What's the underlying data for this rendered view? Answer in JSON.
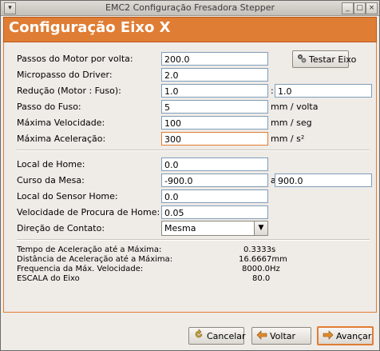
{
  "window": {
    "title": "EMC2 Configuração Fresadora Stepper",
    "menu_icon": "window-menu-icon",
    "min_icon": "minimize-icon",
    "max_icon": "maximize-icon",
    "close_icon": "close-icon"
  },
  "header": {
    "title": "Configuração Eixo X",
    "accent": "#e07d34"
  },
  "motor": {
    "steps_label": "Passos do Motor por volta:",
    "steps_value": "200.0",
    "microstep_label": "Micropasso do Driver:",
    "microstep_value": "2.0",
    "reduction_label": "Redução (Motor : Fuso):",
    "reduction_motor": "1.0",
    "reduction_sep": ":",
    "reduction_screw": "1.0",
    "pitch_label": "Passo do Fuso:",
    "pitch_value": "5",
    "pitch_unit": "mm / volta",
    "maxvel_label": "Máxima Velocidade:",
    "maxvel_value": "100",
    "maxvel_unit": "mm / seg",
    "maxacc_label": "Máxima Aceleração:",
    "maxacc_value": "300",
    "maxacc_unit": "mm / s²"
  },
  "test_button": {
    "label": "Testar Eixo",
    "icon": "gears-icon"
  },
  "home": {
    "home_label": "Local de Home:",
    "home_value": "0.0",
    "travel_label": "Curso da Mesa:",
    "travel_min": "-900.0",
    "travel_sep": "a",
    "travel_max": "900.0",
    "sensor_label": "Local do Sensor Home:",
    "sensor_value": "0.0",
    "search_label": "Velocidade de Procura de Home:",
    "search_value": "0.05",
    "direction_label": "Direção de Contato:",
    "direction_value": "Mesma"
  },
  "calc": [
    {
      "label": "Tempo de Aceleração até a Máxima:",
      "value": "0.3333s"
    },
    {
      "label": "Distância de Aceleração até a Máxima:",
      "value": "16.6667mm"
    },
    {
      "label": "Frequencia da Máx. Velocidade:",
      "value": "8000.0Hz"
    },
    {
      "label": "ESCALA do Eixo",
      "value": "80.0"
    }
  ],
  "footer": {
    "cancel_label": "Cancelar",
    "cancel_icon": "cancel-icon",
    "back_label": "Voltar",
    "back_icon": "back-arrow-icon",
    "next_label": "Avançar",
    "next_icon": "forward-arrow-icon"
  }
}
